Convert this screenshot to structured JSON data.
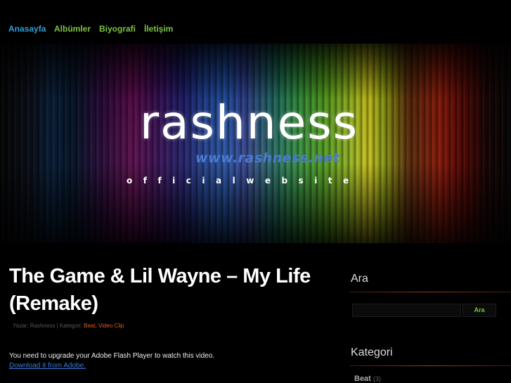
{
  "nav": {
    "items": [
      {
        "label": "Anasayfa"
      },
      {
        "label": "Albümler"
      },
      {
        "label": "Biyografi"
      },
      {
        "label": "İletişim"
      }
    ],
    "colors": {
      "active": "#2e9fd6",
      "inactive": "#7cc243"
    }
  },
  "banner": {
    "logo_text": "rashness",
    "logo_url": "www.rashness.net",
    "tagline": "officialwebsite"
  },
  "post": {
    "title": "The Game & Lil Wayne – My Life (Remake)",
    "meta_prefix": "Yazar: Rashness | Kategori:",
    "categories": "Beat, Video Clip",
    "flash_message": "You need to upgrade your Adobe Flash Player to watch this video.",
    "flash_link": "Download it from Adobe."
  },
  "sidebar": {
    "search_title": "Ara",
    "search_button": "Ara",
    "search_value": "",
    "category_title": "Kategori",
    "categories": [
      {
        "label": "Beat",
        "count": "(3)"
      }
    ]
  }
}
